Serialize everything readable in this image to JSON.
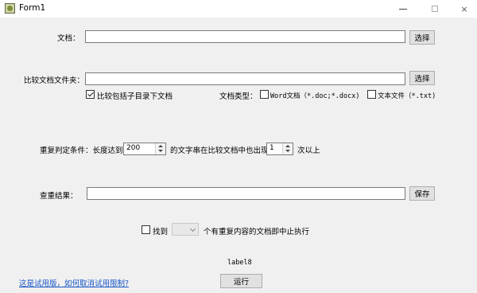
{
  "window": {
    "title": "Form1",
    "icon": "app-icon",
    "minimize": "minimize",
    "maximize": "maximize",
    "close": "×"
  },
  "doc": {
    "label": "文档：",
    "value": "",
    "button": "选择"
  },
  "folder": {
    "label": "比较文档文件夹：",
    "value": "",
    "button": "选择"
  },
  "include_subdirs": {
    "label": "比较包括子目录下文档",
    "checked": true
  },
  "doc_type": {
    "label": "文档类型：",
    "word": {
      "label": "Word文档（*.doc;*.docx)",
      "checked": false
    },
    "text": {
      "label": "文本文件（*.txt)",
      "checked": false
    }
  },
  "repeat": {
    "prefix": "重复判定条件：长度达到",
    "length_value": "200",
    "middle": "的文字串在比较文档中也出现",
    "count_value": "1",
    "suffix": "次以上"
  },
  "result": {
    "label": "查重结果：",
    "value": "",
    "button": "保存"
  },
  "stop": {
    "checkbox_label": "找到",
    "combo_value": "",
    "suffix": "个有重复内容的文档即中止执行",
    "checked": false
  },
  "status_label": "label8",
  "trial_link": "这是试用版，如何取消试用限制?",
  "run_button": "运行"
}
